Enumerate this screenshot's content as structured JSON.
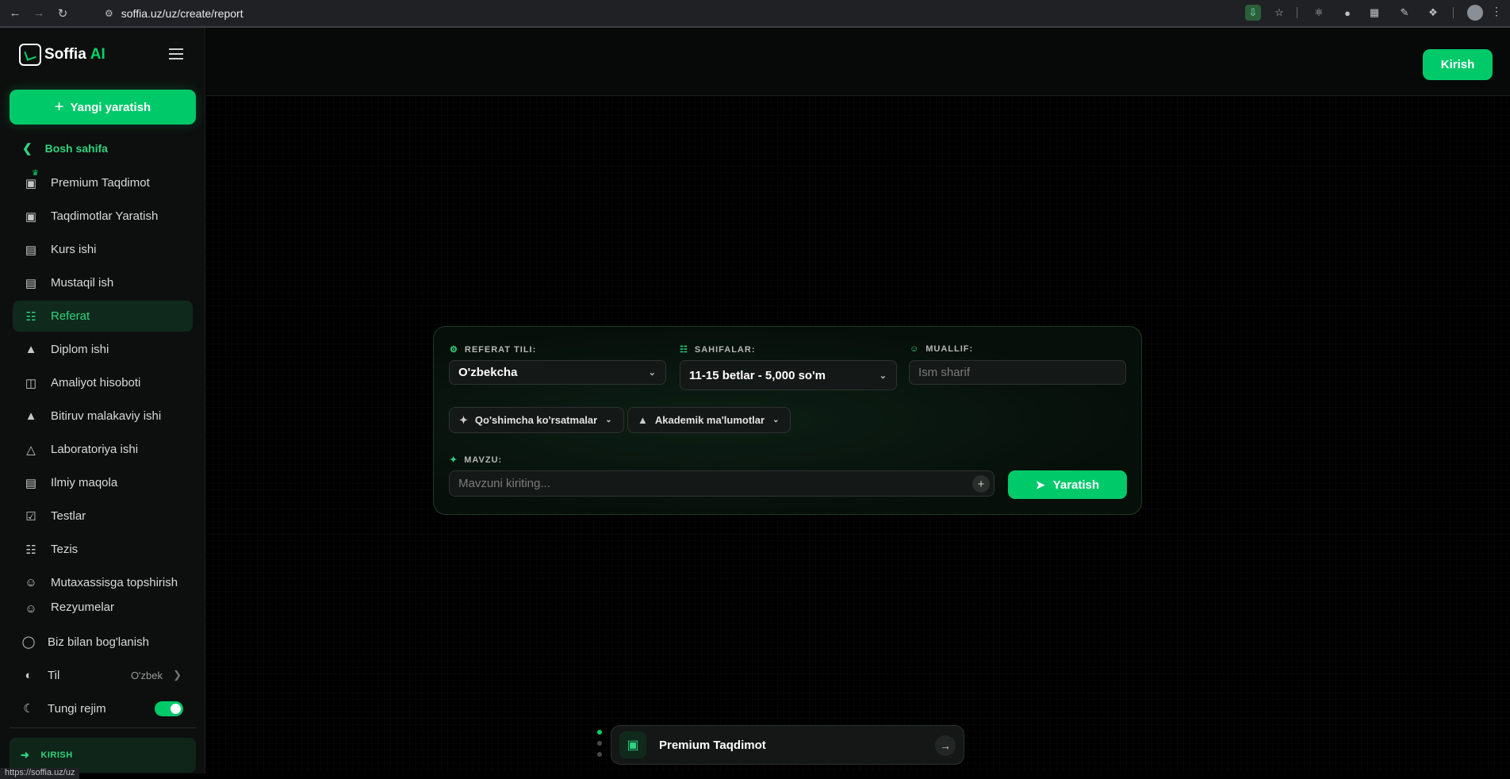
{
  "browser": {
    "url": "soffia.uz/uz/create/report",
    "status_url": "https://soffia.uz/uz"
  },
  "brand": {
    "name": "Soffia",
    "suffix": "AI",
    "accent_color": "#00c96a"
  },
  "sidebar": {
    "new_button": "Yangi yaratish",
    "home_link": "Bosh sahifa",
    "items": [
      {
        "label": "Premium Taqdimot",
        "icon": "presentation-icon"
      },
      {
        "label": "Taqdimotlar Yaratish",
        "icon": "presentation-icon"
      },
      {
        "label": "Kurs ishi",
        "icon": "book-open-icon"
      },
      {
        "label": "Mustaqil ish",
        "icon": "book-open-icon"
      },
      {
        "label": "Referat",
        "icon": "document-icon",
        "active": true
      },
      {
        "label": "Diplom ishi",
        "icon": "graduation-cap-icon"
      },
      {
        "label": "Amaliyot hisoboti",
        "icon": "briefcase-icon"
      },
      {
        "label": "Bitiruv malakaviy ishi",
        "icon": "graduation-cap-icon"
      },
      {
        "label": "Laboratoriya ishi",
        "icon": "flask-icon"
      },
      {
        "label": "Ilmiy maqola",
        "icon": "book-open-icon"
      },
      {
        "label": "Testlar",
        "icon": "clipboard-check-icon"
      },
      {
        "label": "Tezis",
        "icon": "file-text-icon"
      },
      {
        "label": "Mutaxassisga topshirish",
        "icon": "user-icon"
      },
      {
        "label": "Rezyumelar",
        "icon": "user-icon"
      }
    ],
    "contact": "Biz bilan bog'lanish",
    "language_label": "Til",
    "language_value": "O'zbek",
    "night_mode_label": "Tungi rejim",
    "night_mode_on": true,
    "login": "KIRISH"
  },
  "header": {
    "login_button": "Kirish"
  },
  "form": {
    "language_label": "REFERAT TILI:",
    "language_value": "O'zbekcha",
    "pages_label": "SAHIFALAR:",
    "pages_value": "11-15 betlar - 5,000 so'm",
    "author_label": "MUALLIF:",
    "author_placeholder": "Ism sharif",
    "extra_instructions": "Qo'shimcha ko'rsatmalar",
    "academic_info": "Akademik ma'lumotlar",
    "topic_label": "MAVZU:",
    "topic_placeholder": "Mavzuni kiriting...",
    "submit": "Yaratish"
  },
  "promo": {
    "label": "Premium Taqdimot",
    "slide_count": 3,
    "active_slide": 1
  }
}
